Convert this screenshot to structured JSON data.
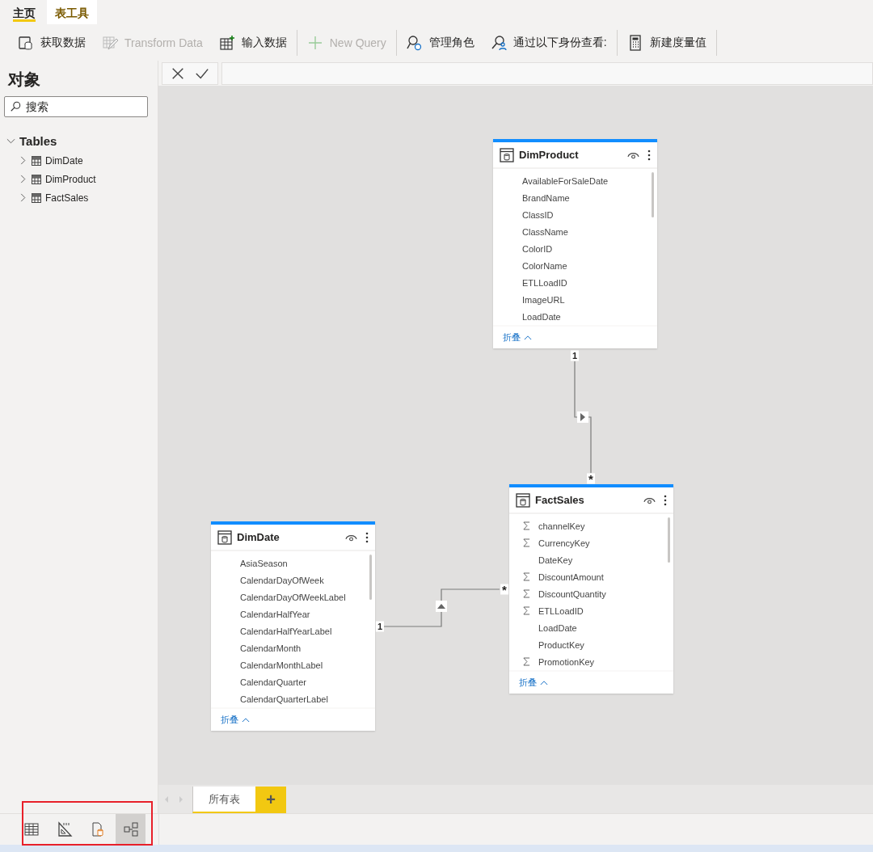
{
  "ribbon_tabs": [
    {
      "label": "主页",
      "selected": true,
      "kind": "standard"
    },
    {
      "label": "表工具",
      "selected": false,
      "kind": "contextual"
    }
  ],
  "toolbar": [
    {
      "label": "获取数据",
      "disabled": false
    },
    {
      "label": "Transform Data",
      "disabled": true
    },
    {
      "label": "输入数据",
      "disabled": false
    },
    {
      "label": "New Query",
      "disabled": true
    },
    {
      "label": "管理角色",
      "disabled": false
    },
    {
      "label": "通过以下身份查看:",
      "disabled": false
    },
    {
      "label": "新建度量值",
      "disabled": false
    }
  ],
  "sidebar": {
    "title": "对象",
    "search": {
      "placeholder": "搜索"
    },
    "tree": [
      {
        "label": "Tables",
        "expanded": true,
        "children": [
          {
            "label": "DimDate",
            "expanded": false
          },
          {
            "label": "DimProduct",
            "expanded": false
          },
          {
            "label": "FactSales",
            "expanded": false
          }
        ]
      }
    ]
  },
  "tables": [
    {
      "name": "DimProduct",
      "collapse_label": "折叠",
      "fields": [
        {
          "name": "AvailableForSaleDate",
          "kind": "plain"
        },
        {
          "name": "BrandName",
          "kind": "plain"
        },
        {
          "name": "ClassID",
          "kind": "plain"
        },
        {
          "name": "ClassName",
          "kind": "plain"
        },
        {
          "name": "ColorID",
          "kind": "plain"
        },
        {
          "name": "ColorName",
          "kind": "plain"
        },
        {
          "name": "ETLLoadID",
          "kind": "plain"
        },
        {
          "name": "ImageURL",
          "kind": "plain"
        },
        {
          "name": "LoadDate",
          "kind": "plain"
        }
      ]
    },
    {
      "name": "FactSales",
      "collapse_label": "折叠",
      "fields": [
        {
          "name": "channelKey",
          "kind": "sum"
        },
        {
          "name": "CurrencyKey",
          "kind": "sum"
        },
        {
          "name": "DateKey",
          "kind": "plain"
        },
        {
          "name": "DiscountAmount",
          "kind": "sum"
        },
        {
          "name": "DiscountQuantity",
          "kind": "sum"
        },
        {
          "name": "ETLLoadID",
          "kind": "sum"
        },
        {
          "name": "LoadDate",
          "kind": "plain"
        },
        {
          "name": "ProductKey",
          "kind": "plain"
        },
        {
          "name": "PromotionKey",
          "kind": "sum"
        }
      ]
    },
    {
      "name": "DimDate",
      "collapse_label": "折叠",
      "fields": [
        {
          "name": "AsiaSeason",
          "kind": "plain"
        },
        {
          "name": "CalendarDayOfWeek",
          "kind": "plain"
        },
        {
          "name": "CalendarDayOfWeekLabel",
          "kind": "plain"
        },
        {
          "name": "CalendarHalfYear",
          "kind": "plain"
        },
        {
          "name": "CalendarHalfYearLabel",
          "kind": "plain"
        },
        {
          "name": "CalendarMonth",
          "kind": "plain"
        },
        {
          "name": "CalendarMonthLabel",
          "kind": "plain"
        },
        {
          "name": "CalendarQuarter",
          "kind": "plain"
        },
        {
          "name": "CalendarQuarterLabel",
          "kind": "plain"
        }
      ]
    }
  ],
  "relationships": [
    {
      "one_label": "1",
      "many_label": "*"
    },
    {
      "one_label": "1",
      "many_label": "*"
    }
  ],
  "page_tabs": [
    {
      "label": "所有表",
      "selected": true
    }
  ],
  "add_page": "+",
  "views": [
    {
      "selected": false
    },
    {
      "selected": false
    },
    {
      "selected": false
    },
    {
      "selected": true
    }
  ]
}
